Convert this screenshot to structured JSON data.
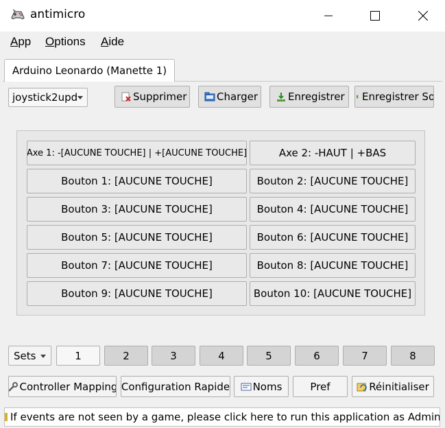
{
  "window": {
    "title": "antimicro",
    "icon": "gamepad-icon"
  },
  "menu": {
    "items": [
      {
        "label": "App",
        "underline": "A"
      },
      {
        "label": "Options",
        "underline": "O"
      },
      {
        "label": "Aide",
        "underline": "A"
      }
    ]
  },
  "tab": {
    "label": "Arduino Leonardo (Manette 1)"
  },
  "toolbar": {
    "profile_value": "joystick2upd",
    "delete_label": "Supprimer",
    "load_label": "Charger",
    "save_label": "Enregistrer",
    "save_as_label": "Enregistrer Sou"
  },
  "controls": {
    "axis1": "Axe 1: -[AUCUNE TOUCHE] | +[AUCUNE TOUCHE]",
    "axis2": "Axe 2: -HAUT | +BAS",
    "buttons": [
      "Bouton 1: [AUCUNE TOUCHE]",
      "Bouton 2: [AUCUNE TOUCHE]",
      "Bouton 3: [AUCUNE TOUCHE]",
      "Bouton 4: [AUCUNE TOUCHE]",
      "Bouton 5: [AUCUNE TOUCHE]",
      "Bouton 6: [AUCUNE TOUCHE]",
      "Bouton 7: [AUCUNE TOUCHE]",
      "Bouton 8: [AUCUNE TOUCHE]",
      "Bouton 9: [AUCUNE TOUCHE]",
      "Bouton 10: [AUCUNE TOUCHE]"
    ]
  },
  "sets": {
    "combo_label": "Sets",
    "items": [
      "1",
      "2",
      "3",
      "4",
      "5",
      "6",
      "7",
      "8"
    ],
    "active": "1"
  },
  "bottom": {
    "mapping_label": "Controller Mapping",
    "quick_config_label": "Configuration Rapide",
    "names_label": "Noms",
    "pref_label": "Pref",
    "reset_label": "Réinitialiser"
  },
  "status": {
    "text": "If events are not seen by a game, please click here to run this application as Administrator."
  }
}
